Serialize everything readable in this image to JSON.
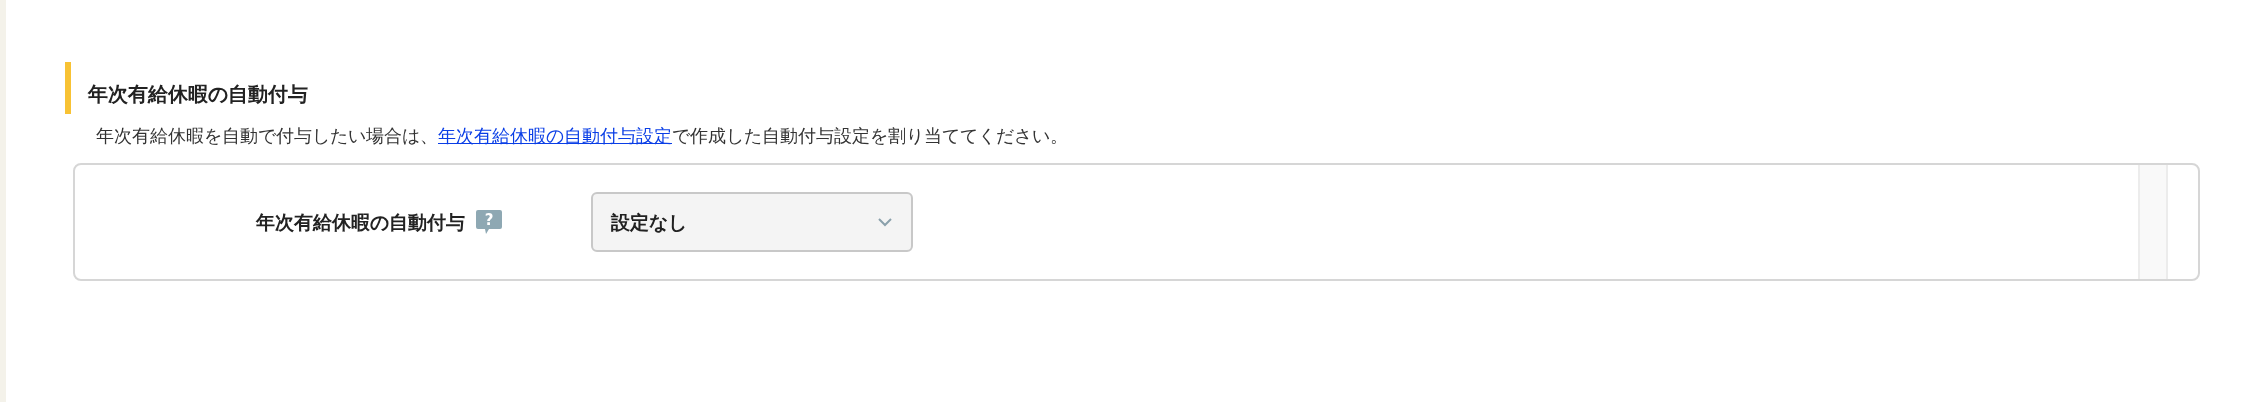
{
  "section": {
    "title": "年次有給休暇の自動付与",
    "description_before": "年次有給休暇を自動で付与したい場合は、",
    "description_link": "年次有給休暇の自動付与設定",
    "description_after": "で作成した自動付与設定を割り当ててください。"
  },
  "fields": [
    {
      "label": "年次有給休暇の自動付与",
      "help": "?",
      "kind": "select",
      "value": "設定なし"
    }
  ]
}
